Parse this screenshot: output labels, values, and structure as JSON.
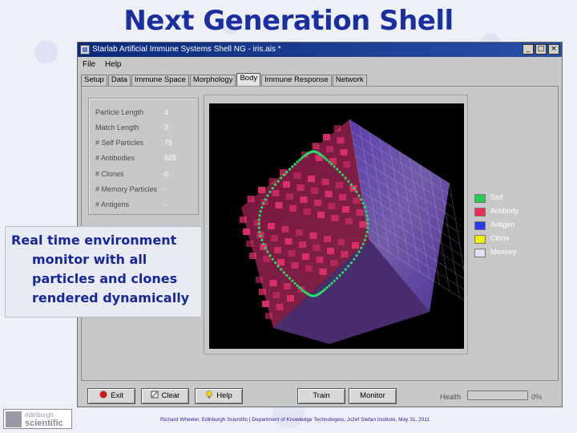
{
  "slide": {
    "title": "Next Generation Shell",
    "caption_lines": [
      "Real time environment",
      "monitor with all",
      "particles and clones",
      "rendered dynamically"
    ],
    "footer": "Richard Wheeler, Edinburgh Scientific  |  Department of Knowledge Technologies, Jožef Stefan Institute, May 31, 2011",
    "logo_top": "edinburgh",
    "logo_bottom": "scientific"
  },
  "window": {
    "title": "Starlab Artificial Immune Systems Shell NG - iris.ais *",
    "controls": {
      "minimize": "_",
      "maximize": "□",
      "close": "×"
    },
    "menu": [
      "File",
      "Help"
    ],
    "tabs": [
      {
        "label": "Setup",
        "active": false
      },
      {
        "label": "Data",
        "active": false
      },
      {
        "label": "Immune Space",
        "active": false
      },
      {
        "label": "Morphology",
        "active": false
      },
      {
        "label": "Body",
        "active": true
      },
      {
        "label": "Immune Response",
        "active": false
      },
      {
        "label": "Network",
        "active": false
      }
    ]
  },
  "stats": [
    {
      "label": "Particle Length",
      "value": "4"
    },
    {
      "label": "Match Length",
      "value": "2"
    },
    {
      "label": "# Self Particles",
      "value": "75"
    },
    {
      "label": "# Antibodies",
      "value": "525"
    },
    {
      "label": "# Clones",
      "value": "0"
    },
    {
      "label": "# Memory Particles",
      "value": "-"
    },
    {
      "label": "# Antigens",
      "value": "-"
    }
  ],
  "legend": [
    {
      "label": "Self",
      "color": "#22cc55"
    },
    {
      "label": "Antibody",
      "color": "#ee2a55"
    },
    {
      "label": "Antigen",
      "color": "#2a3aee"
    },
    {
      "label": "Clone",
      "color": "#f0f000"
    },
    {
      "label": "Memory",
      "color": "#e0e0f4"
    }
  ],
  "buttons": [
    {
      "label": "Exit",
      "icon": "stop-icon"
    },
    {
      "label": "Clear",
      "icon": "clear-icon"
    },
    {
      "label": "Help",
      "icon": "bulb-icon"
    },
    {
      "label": "Train",
      "icon": ""
    },
    {
      "label": "Monitor",
      "icon": ""
    }
  ],
  "health": {
    "label": "Health",
    "percent_text": "0%",
    "fraction": 0
  },
  "colors": {
    "title_blue": "#1b2fa0",
    "caption_blue": "#16289a",
    "antibody_pink": "#e0306a",
    "memory_violet": "#8a66d8",
    "self_green": "#22dd66"
  }
}
